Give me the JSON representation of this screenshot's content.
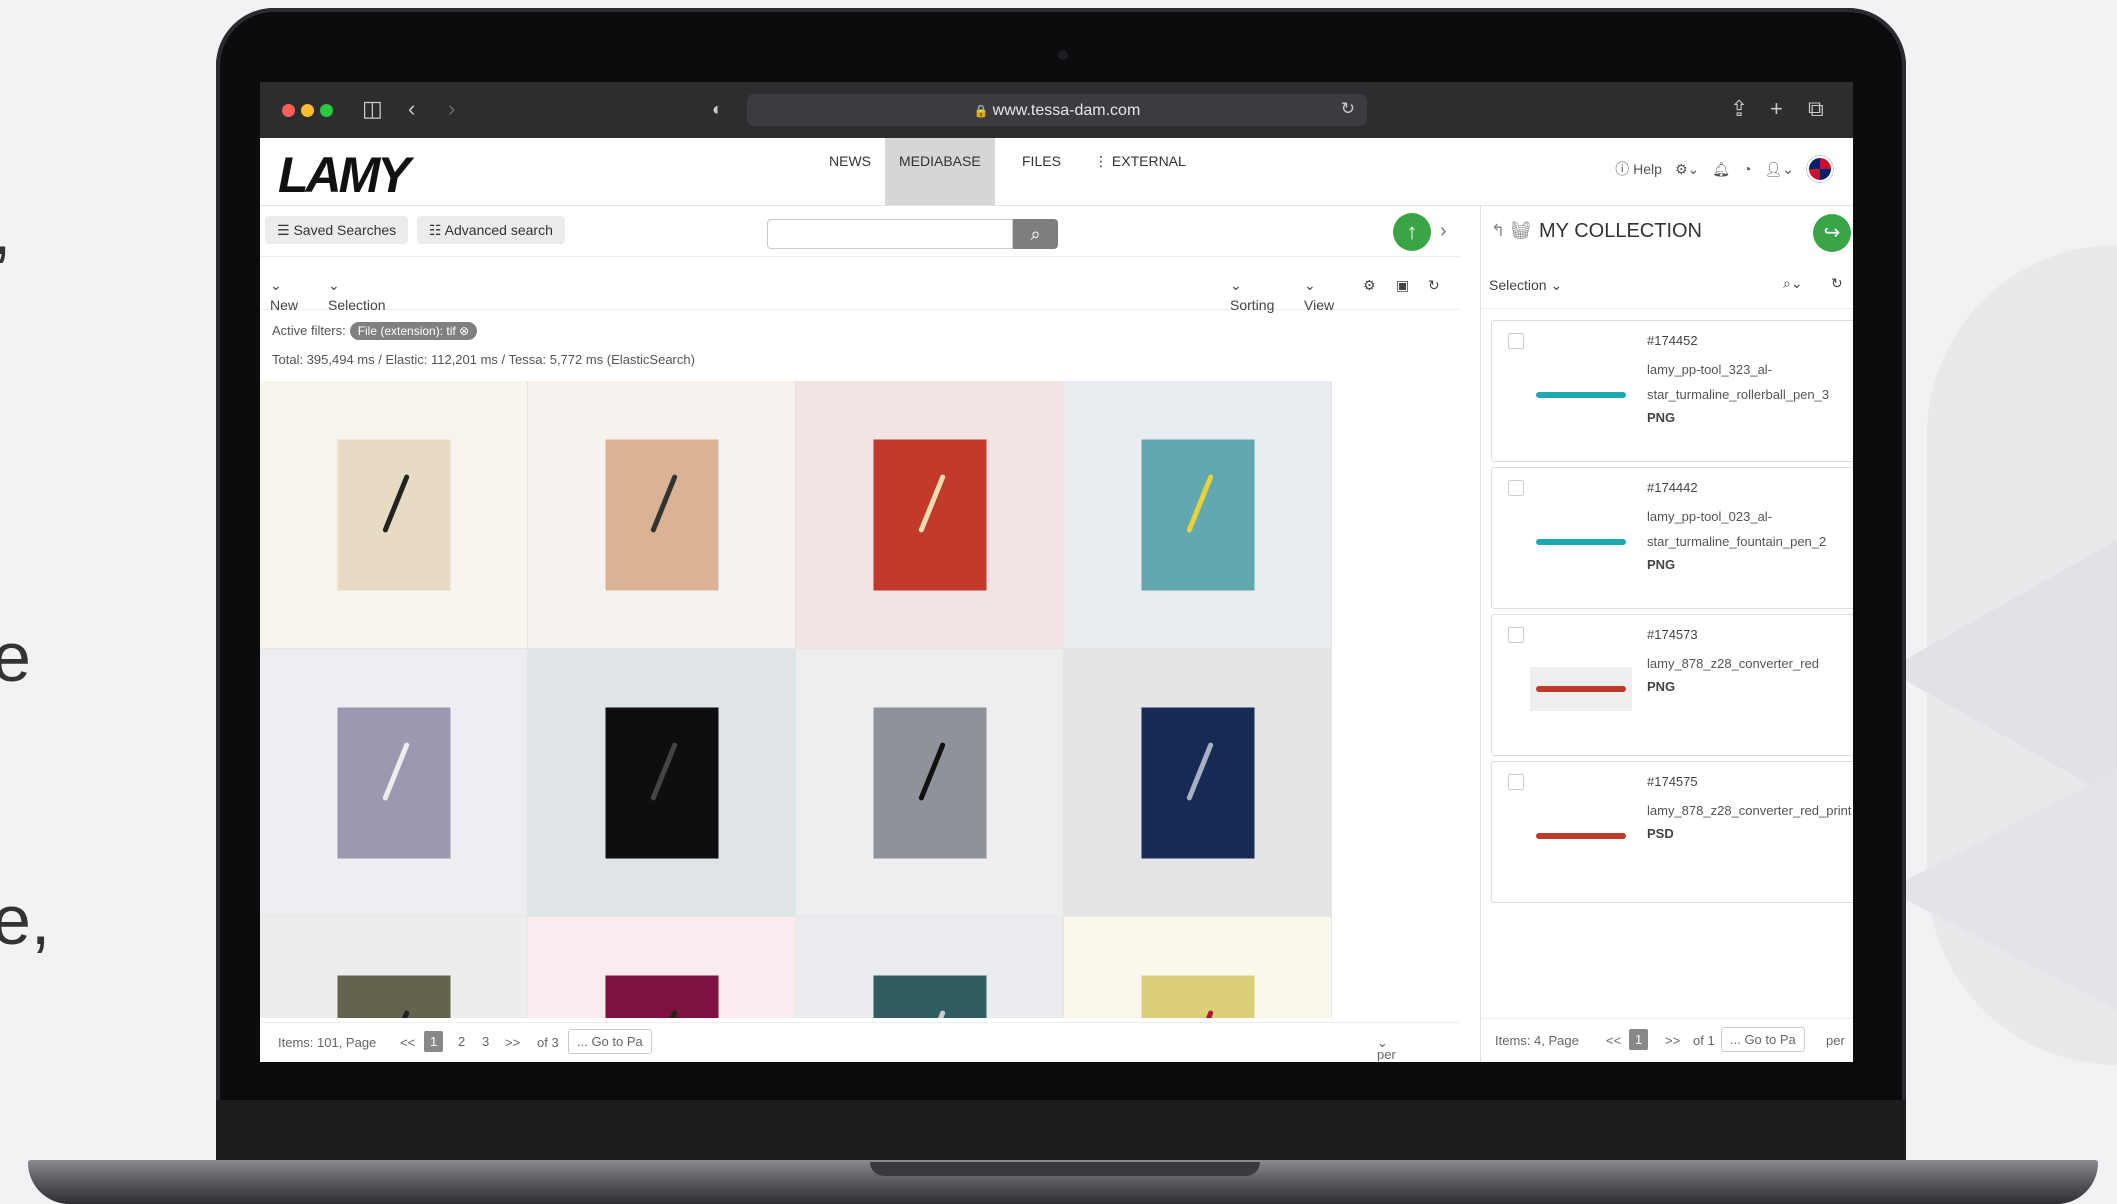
{
  "browser": {
    "url": "www.tessa-dam.com"
  },
  "header": {
    "logo": "LAMY",
    "nav": [
      {
        "label": "NEWS"
      },
      {
        "label": "MEDIABASE"
      },
      {
        "label": "FILES"
      },
      {
        "label": "EXTERNAL"
      }
    ],
    "help_label": "Help"
  },
  "toolbar": {
    "saved_searches": "Saved Searches",
    "advanced_search": "Advanced search",
    "search_value": "",
    "new_label": "New",
    "selection_label": "Selection",
    "sorting_label": "Sorting",
    "view_label": "View"
  },
  "filters": {
    "label": "Active filters:",
    "chip": "File (extension): tif",
    "timing": "Total: 395,494 ms / Elastic: 112,201 ms / Tessa: 5,772 ms (ElasticSearch)"
  },
  "grid": {
    "items": [
      {
        "bg": "#f7f4ec",
        "thumb": "#e7dcc3",
        "pen": "#222"
      },
      {
        "bg": "#f8f2ee",
        "thumb": "#d9b393",
        "pen": "#333"
      },
      {
        "bg": "#f3e4e4",
        "thumb": "#c23a2a",
        "pen": "#f0dcb0"
      },
      {
        "bg": "#e9edf1",
        "thumb": "#63a7b0",
        "pen": "#e6d23b"
      },
      {
        "bg": "#efedf2",
        "thumb": "#9c98b0",
        "pen": "#eee"
      },
      {
        "bg": "#dfe4e6",
        "thumb": "#0e0e10",
        "pen": "#444"
      },
      {
        "bg": "#eeeef0",
        "thumb": "#8f9298",
        "pen": "#111"
      },
      {
        "bg": "#e4e4e6",
        "thumb": "#172a54",
        "pen": "#a7b0c4"
      },
      {
        "bg": "#ededed",
        "thumb": "#65624d",
        "pen": "#222"
      },
      {
        "bg": "#f8ecef",
        "thumb": "#7d1240",
        "pen": "#222"
      },
      {
        "bg": "#ebecef",
        "thumb": "#2f5d60",
        "pen": "#ccc"
      },
      {
        "bg": "#faf7ed",
        "thumb": "#ddcf7a",
        "pen": "#b2182b"
      }
    ]
  },
  "footer": {
    "items_label": "Items: 101, Page",
    "first": "<<",
    "pages": [
      "1",
      "2",
      "3"
    ],
    "next": ">>",
    "of_label": "of 3",
    "goto": "... Go to Pa",
    "per_view": "per View"
  },
  "collection": {
    "title": "MY COLLECTION",
    "selection_label": "Selection",
    "items": [
      {
        "id": "#174452",
        "name": "lamy_pp-tool_323_al-star_turmaline_rollerball_pen_3",
        "type": "PNG",
        "img": "#1fa7b0",
        "imgbg": "#fff"
      },
      {
        "id": "#174442",
        "name": "lamy_pp-tool_023_al-star_turmaline_fountain_pen_2",
        "type": "PNG",
        "img": "#1fa7b0",
        "imgbg": "#fff"
      },
      {
        "id": "#174573",
        "name": "lamy_878_z28_converter_red",
        "type": "PNG",
        "img": "#c0392b",
        "imgbg": "#eee"
      },
      {
        "id": "#174575",
        "name": "lamy_878_z28_converter_red_print",
        "type": "PSD",
        "img": "#c0392b",
        "imgbg": "#fff"
      }
    ],
    "footer": {
      "items_label": "Items: 4, Page",
      "first": "<<",
      "page": "1",
      "next": ">>",
      "of_label": "of 1",
      "goto": "... Go to Pa",
      "per": "per"
    }
  }
}
